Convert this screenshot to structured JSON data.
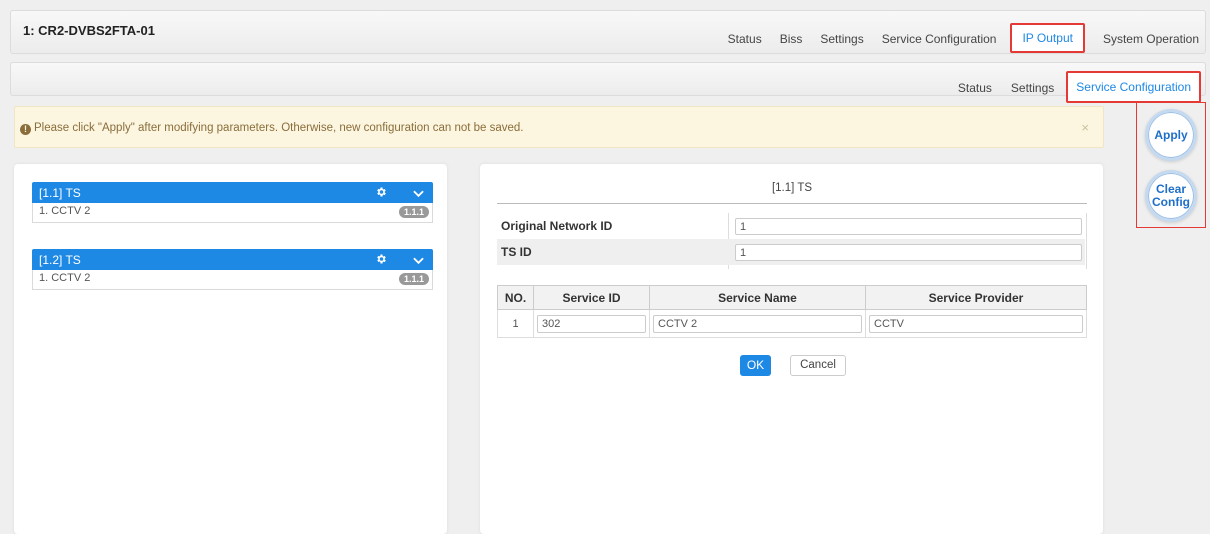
{
  "header": {
    "device_title": "1: CR2-DVBS2FTA-01",
    "nav": [
      {
        "label": "Status"
      },
      {
        "label": "Biss"
      },
      {
        "label": "Settings"
      },
      {
        "label": "Service Configuration"
      },
      {
        "label": "IP Output",
        "active": true
      },
      {
        "label": "System Operation"
      }
    ]
  },
  "subnav": [
    {
      "label": "Status"
    },
    {
      "label": "Settings"
    },
    {
      "label": "Service Configuration",
      "active": true
    }
  ],
  "alert": {
    "message": "Please click \"Apply\" after modifying parameters. Otherwise, new configuration can not be saved.",
    "close": "×",
    "icon": "info-icon"
  },
  "actions": {
    "apply_label": "Apply",
    "clear_label_line1": "Clear",
    "clear_label_line2": "Config"
  },
  "ts_list": [
    {
      "title": "[1.1] TS",
      "items": [
        {
          "label": "1. CCTV 2",
          "badge": "1.1.1"
        }
      ]
    },
    {
      "title": "[1.2] TS",
      "items": [
        {
          "label": "1. CCTV 2",
          "badge": "1.1.1"
        }
      ]
    }
  ],
  "form": {
    "title": "[1.1] TS",
    "original_network_id_label": "Original Network ID",
    "original_network_id_value": "1",
    "ts_id_label": "TS ID",
    "ts_id_value": "1",
    "table": {
      "headers": [
        "NO.",
        "Service ID",
        "Service Name",
        "Service Provider"
      ],
      "rows": [
        {
          "no": "1",
          "service_id": "302",
          "service_name": "CCTV 2",
          "service_provider": "CCTV"
        }
      ]
    },
    "ok_label": "OK",
    "cancel_label": "Cancel"
  },
  "colors": {
    "accent": "#1e88e5",
    "highlight_border": "#e53935",
    "alert_bg": "#fcf6e0",
    "alert_text": "#8a6d3b"
  }
}
